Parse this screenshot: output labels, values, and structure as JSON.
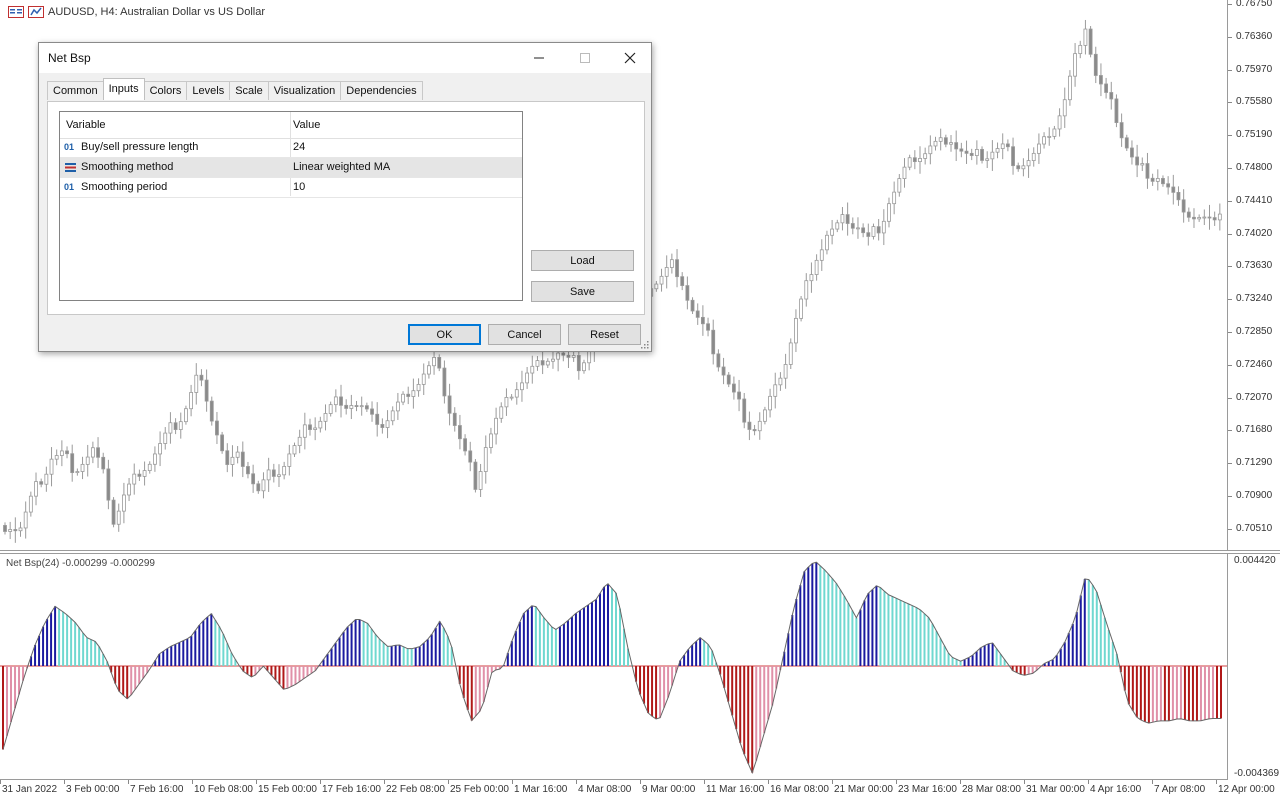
{
  "chart": {
    "title": "AUDUSD, H4:  Australian Dollar vs US Dollar",
    "price_labels": [
      "0.76750",
      "0.76360",
      "0.75970",
      "0.75580",
      "0.75190",
      "0.74800",
      "0.74410",
      "0.74020",
      "0.73630",
      "0.73240",
      "0.72850",
      "0.72460",
      "0.72070",
      "0.71680",
      "0.71290",
      "0.70900",
      "0.70510"
    ],
    "indicator_title": "Net Bsp(24) -0.000299 -0.000299",
    "indicator_labels": [
      "0.004420",
      "-0.004369"
    ],
    "time_labels": [
      "31 Jan 2022",
      "3 Feb 00:00",
      "7 Feb 16:00",
      "10 Feb 08:00",
      "15 Feb 00:00",
      "17 Feb 16:00",
      "22 Feb 08:00",
      "25 Feb 00:00",
      "1 Mar 16:00",
      "4 Mar 08:00",
      "9 Mar 00:00",
      "11 Mar 16:00",
      "16 Mar 08:00",
      "21 Mar 00:00",
      "23 Mar 16:00",
      "28 Mar 08:00",
      "31 Mar 00:00",
      "4 Apr 16:00",
      "7 Apr 08:00",
      "12 Apr 00:00"
    ],
    "colors": {
      "up_strong": "#1a1aa0",
      "up_weak": "#6fd8d0",
      "down_strong": "#b01818",
      "down_weak": "#e090a8",
      "candle": "#9a9a9a",
      "zero_line": "#d04040"
    },
    "price_series": [
      0.7055,
      0.7052,
      0.7085,
      0.711,
      0.7135,
      0.714,
      0.7125,
      0.713,
      0.7145,
      0.7115,
      0.706,
      0.709,
      0.711,
      0.7125,
      0.714,
      0.716,
      0.7175,
      0.7195,
      0.723,
      0.721,
      0.7165,
      0.7125,
      0.7135,
      0.712,
      0.7095,
      0.7115,
      0.712,
      0.714,
      0.7155,
      0.7175,
      0.718,
      0.7195,
      0.7205,
      0.72,
      0.7195,
      0.718,
      0.7175,
      0.719,
      0.7205,
      0.722,
      0.7235,
      0.725,
      0.7215,
      0.7175,
      0.714,
      0.7105,
      0.715,
      0.718,
      0.72,
      0.722,
      0.7235,
      0.7245,
      0.7255,
      0.726,
      0.725,
      0.7245,
      0.7265,
      0.7275,
      0.73,
      0.7315,
      0.733,
      0.732,
      0.734,
      0.735,
      0.7365,
      0.7345,
      0.731,
      0.729,
      0.7265,
      0.7235,
      0.721,
      0.7185,
      0.717,
      0.719,
      0.7215,
      0.725,
      0.73,
      0.734,
      0.7375,
      0.74,
      0.741,
      0.742,
      0.741,
      0.7395,
      0.741,
      0.744,
      0.7465,
      0.7485,
      0.7495,
      0.7505,
      0.751,
      0.7515,
      0.75,
      0.749,
      0.7495,
      0.75,
      0.7505,
      0.749,
      0.7485,
      0.7495,
      0.751,
      0.753,
      0.756,
      0.761,
      0.765,
      0.759,
      0.7565,
      0.754,
      0.7505,
      0.748,
      0.7475,
      0.747,
      0.7455,
      0.7435,
      0.7425,
      0.742,
      0.7415,
      0.743
    ],
    "indicator_series": [
      -0.0035,
      -0.002,
      -0.0005,
      0.0008,
      0.0018,
      0.0025,
      0.0022,
      0.0018,
      0.0012,
      0.001,
      0.0002,
      -0.001,
      -0.0014,
      -0.0008,
      -0.0002,
      0.0005,
      0.0008,
      0.001,
      0.0012,
      0.0018,
      0.0022,
      0.0015,
      0.0005,
      -0.0002,
      -0.0005,
      0.0,
      -0.0005,
      -0.001,
      -0.0008,
      -0.0005,
      -0.0002,
      0.0004,
      0.001,
      0.0016,
      0.002,
      0.0018,
      0.0012,
      0.0008,
      0.0009,
      0.0007,
      0.0008,
      0.0012,
      0.0019,
      0.001,
      -0.001,
      -0.0023,
      -0.0018,
      -0.0002,
      -0.0001,
      0.0012,
      0.0022,
      0.0026,
      0.002,
      0.0015,
      0.0018,
      0.0022,
      0.0025,
      0.0028,
      0.0035,
      0.003,
      0.0008,
      -0.001,
      -0.002,
      -0.0023,
      -0.0012,
      0.0002,
      0.0008,
      0.0012,
      0.0008,
      -0.0005,
      -0.002,
      -0.0035,
      -0.0045,
      -0.003,
      -0.0015,
      0.0005,
      0.0025,
      0.004,
      0.0044,
      0.004,
      0.0035,
      0.0028,
      0.002,
      0.003,
      0.0034,
      0.003,
      0.0028,
      0.0026,
      0.0024,
      0.002,
      0.0012,
      0.0004,
      0.0002,
      0.0004,
      0.0008,
      0.001,
      0.0004,
      -0.0002,
      -0.0004,
      -0.0003,
      0.0001,
      0.0003,
      0.001,
      0.002,
      0.0038,
      0.0032,
      0.0018,
      0.0005,
      -0.0015,
      -0.0022,
      -0.0024,
      -0.0023,
      -0.0023,
      -0.0022,
      -0.0023,
      -0.0023,
      -0.0022,
      -0.0022
    ]
  },
  "dialog": {
    "title": "Net Bsp",
    "tabs": [
      "Common",
      "Inputs",
      "Colors",
      "Levels",
      "Scale",
      "Visualization",
      "Dependencies"
    ],
    "active_tab": "Inputs",
    "columns": {
      "variable": "Variable",
      "value": "Value"
    },
    "rows": [
      {
        "icon": "number-input-icon",
        "name": "Buy/sell pressure length",
        "value": "24"
      },
      {
        "icon": "enum-input-icon",
        "name": "Smoothing method",
        "value": "Linear weighted MA"
      },
      {
        "icon": "number-input-icon",
        "name": "Smoothing period",
        "value": "10"
      }
    ],
    "buttons": {
      "load": "Load",
      "save": "Save",
      "ok": "OK",
      "cancel": "Cancel",
      "reset": "Reset"
    }
  }
}
